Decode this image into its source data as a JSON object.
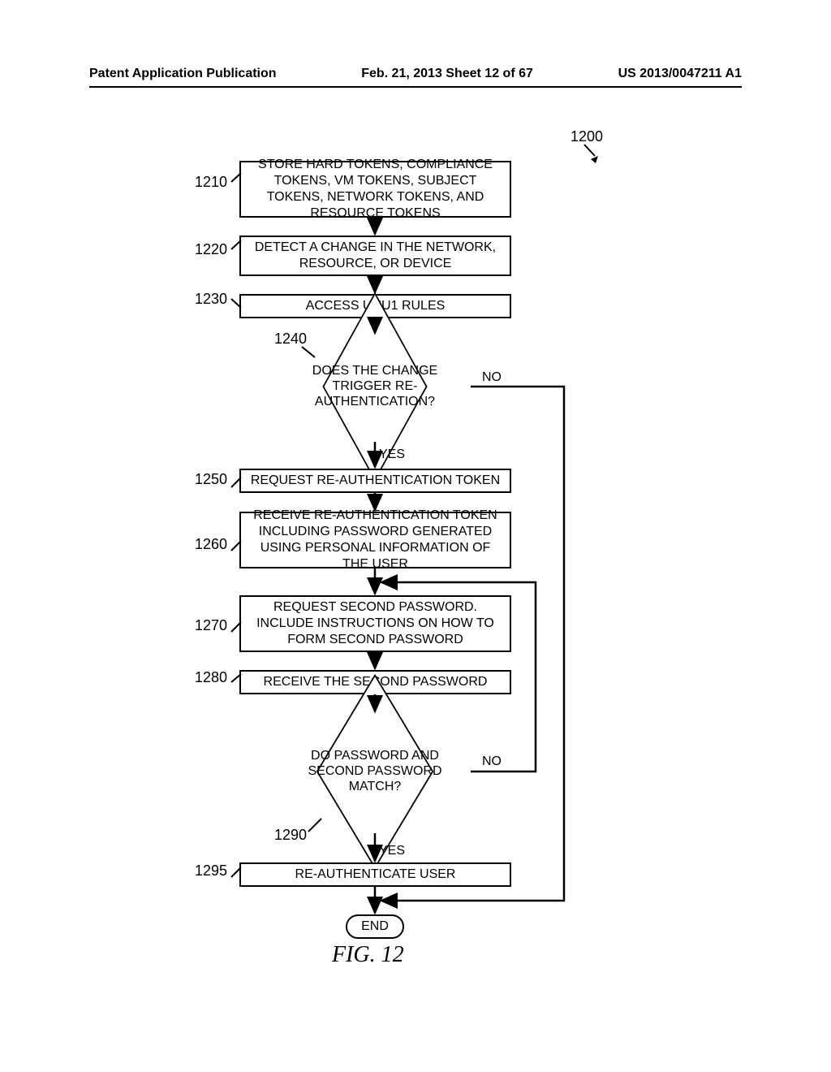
{
  "header": {
    "left": "Patent Application Publication",
    "center": "Feb. 21, 2013  Sheet 12 of 67",
    "right": "US 2013/0047211 A1"
  },
  "refnum_main": "1200",
  "steps": {
    "s1210": {
      "ref": "1210",
      "text": "STORE HARD TOKENS, COMPLIANCE TOKENS, VM TOKENS, SUBJECT TOKENS, NETWORK TOKENS, AND RESOURCE TOKENS"
    },
    "s1220": {
      "ref": "1220",
      "text": "DETECT A CHANGE IN THE NETWORK, RESOURCE, OR DEVICE"
    },
    "s1230": {
      "ref": "1230",
      "text": "ACCESS UUU1 RULES"
    },
    "s1240": {
      "ref": "1240",
      "text": "DOES THE CHANGE TRIGGER RE-AUTHENTICATION?"
    },
    "s1250": {
      "ref": "1250",
      "text": "REQUEST RE-AUTHENTICATION TOKEN"
    },
    "s1260": {
      "ref": "1260",
      "text": "RECEIVE RE-AUTHENTICATION TOKEN INCLUDING PASSWORD GENERATED USING PERSONAL INFORMATION OF THE USER"
    },
    "s1270": {
      "ref": "1270",
      "text": "REQUEST SECOND PASSWORD. INCLUDE INSTRUCTIONS ON HOW TO FORM SECOND PASSWORD"
    },
    "s1280": {
      "ref": "1280",
      "text": "RECEIVE THE SECOND PASSWORD"
    },
    "s1290": {
      "ref": "1290",
      "text": "DO PASSWORD AND SECOND PASSWORD MATCH?"
    },
    "s1295": {
      "ref": "1295",
      "text": "RE-AUTHENTICATE USER"
    }
  },
  "branch": {
    "yes": "YES",
    "no": "NO"
  },
  "terminator": {
    "end": "END"
  },
  "caption": "FIG. 12"
}
